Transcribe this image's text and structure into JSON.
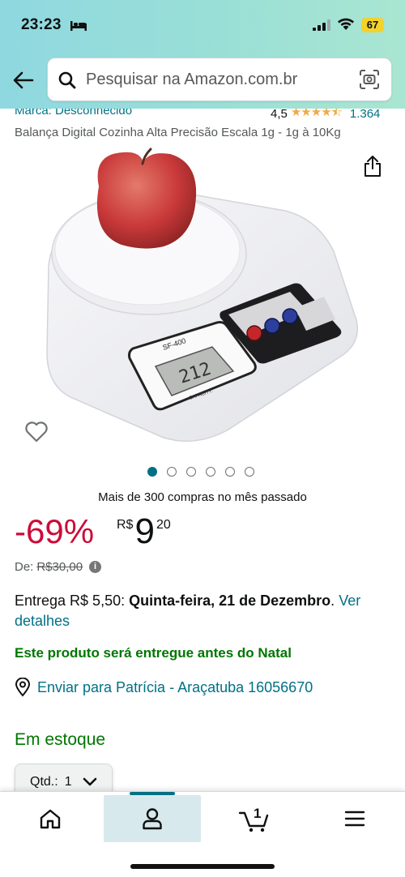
{
  "status_bar": {
    "time": "23:23",
    "battery": "67"
  },
  "header": {
    "search_placeholder": "Pesquisar na Amazon.com.br"
  },
  "product": {
    "brand": "Marca: Desconhecido",
    "rating_value": "4,5",
    "rating_stars": "★★★★⯪",
    "rating_count": "1.364",
    "title": "Balança Digital Cozinha Alta Precisão Escala 1g - 1g à 10Kg",
    "image_scale_model": "SF-400",
    "image_display": "212",
    "image_capacity_label": "CAPACITY:",
    "image_count": 6,
    "image_active_index": 0,
    "bought_text": "Mais de 300 compras no mês passado"
  },
  "pricing": {
    "discount": "-69%",
    "currency": "R$",
    "price_whole": "9",
    "price_cents": "20",
    "was_label": "De:",
    "was_price": "R$30,00"
  },
  "delivery": {
    "prefix": "Entrega R$ 5,50: ",
    "date": "Quinta-feira, 21 de Dezembro",
    "suffix": ". ",
    "link": "Ver detalhes",
    "christmas_note": "Este produto será entregue antes do Natal",
    "ship_to": "Enviar para Patrícia - Araçatuba 16056670"
  },
  "availability": {
    "stock": "Em estoque",
    "qty_label": "Qtd.:",
    "qty_value": "1"
  },
  "bottom_nav": {
    "items": [
      "home-icon",
      "account-icon",
      "cart-icon",
      "menu-icon"
    ],
    "cart_count": "1",
    "active": "account-icon"
  },
  "colors": {
    "link": "#007185",
    "discount": "#cc0c39",
    "success": "#007600",
    "star": "#f3a847"
  }
}
